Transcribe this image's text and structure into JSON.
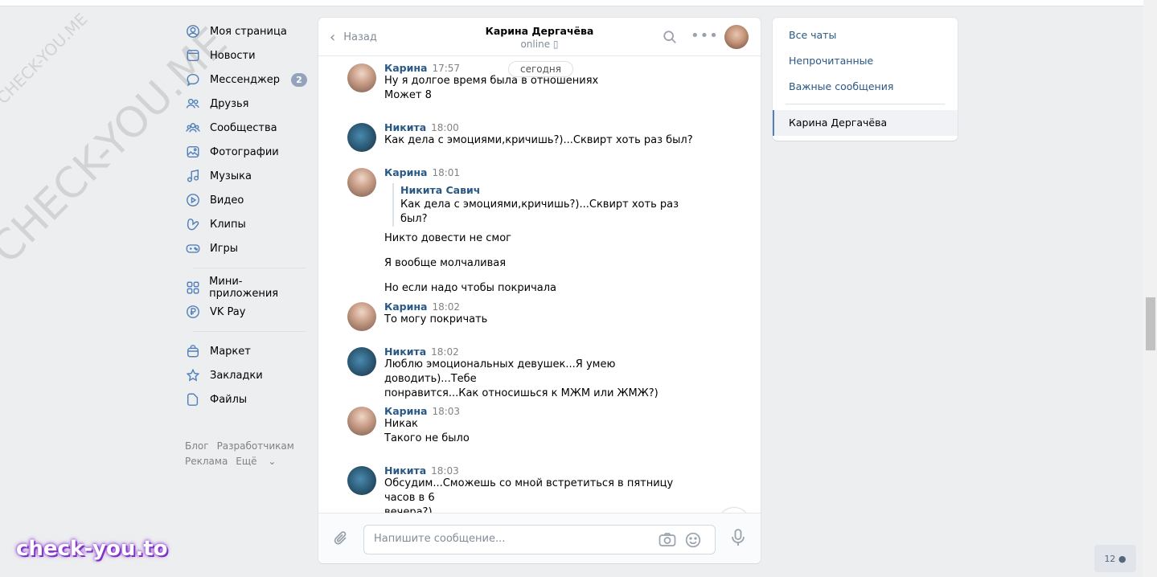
{
  "watermarks": {
    "small": "CHECK-YOU.ME",
    "large": "CHECK-YOU.ME",
    "brand": "check-you.to"
  },
  "nav": {
    "items": [
      {
        "label": "Моя страница",
        "icon": "user-circle-icon"
      },
      {
        "label": "Новости",
        "icon": "newspaper-icon"
      },
      {
        "label": "Мессенджер",
        "icon": "chat-bubble-icon",
        "badge": "2"
      },
      {
        "label": "Друзья",
        "icon": "friends-icon"
      },
      {
        "label": "Сообщества",
        "icon": "communities-icon"
      },
      {
        "label": "Фотографии",
        "icon": "photo-icon"
      },
      {
        "label": "Музыка",
        "icon": "music-note-icon"
      },
      {
        "label": "Видео",
        "icon": "play-circle-icon"
      },
      {
        "label": "Клипы",
        "icon": "clips-icon"
      },
      {
        "label": "Игры",
        "icon": "gamepad-icon"
      }
    ],
    "items2": [
      {
        "label": "Мини-приложения",
        "icon": "grid-icon"
      },
      {
        "label": "VK Pay",
        "icon": "ruble-circle-icon"
      }
    ],
    "items3": [
      {
        "label": "Маркет",
        "icon": "bag-icon"
      },
      {
        "label": "Закладки",
        "icon": "star-icon"
      },
      {
        "label": "Файлы",
        "icon": "file-icon"
      }
    ],
    "footer": {
      "blog": "Блог",
      "dev": "Разработчикам",
      "ads": "Реклама",
      "more": "Ещё"
    }
  },
  "chat": {
    "back_label": "Назад",
    "peer_name": "Карина Дергачёва",
    "peer_status": "online",
    "date_pill": "сегодня",
    "messages": [
      {
        "author": "Карина",
        "time": "17:57",
        "lines": [
          "Ну я долгое время была в отношениях",
          "Может 8"
        ]
      },
      {
        "author": "Никита",
        "time": "18:00",
        "lines": [
          "Как дела с эмоциями,кричишь?)...Сквирт хоть раз был?"
        ]
      },
      {
        "author": "Карина",
        "time": "18:01",
        "quote": {
          "author": "Никита Савич",
          "text": "Как дела с эмоциями,кричишь?)...Сквирт хоть раз был?"
        },
        "lines": [
          "Никто довести не смог",
          "Я вообще молчаливая",
          "Но если надо чтобы покричала"
        ]
      },
      {
        "author": "Карина",
        "time": "18:02",
        "lines": [
          "То могу покричать"
        ]
      },
      {
        "author": "Никита",
        "time": "18:02",
        "lines": [
          "Люблю эмоциональных девушек...Я умею доводить)...Тебе",
          "понравится...Как относишься к МЖМ или ЖМЖ?)"
        ]
      },
      {
        "author": "Карина",
        "time": "18:03",
        "lines": [
          "Никак",
          "Такого не было"
        ]
      },
      {
        "author": "Никита",
        "time": "18:03",
        "lines": [
          "Обсудим...Сможешь со мной встретиться в пятницу часов в 6",
          "вечера?)"
        ]
      }
    ],
    "composer_placeholder": "Напишите сообщение..."
  },
  "filters": {
    "all": "Все чаты",
    "unread": "Непрочитанные",
    "important": "Важные сообщения",
    "active": "Карина Дергачёва"
  },
  "online_counter": "12"
}
